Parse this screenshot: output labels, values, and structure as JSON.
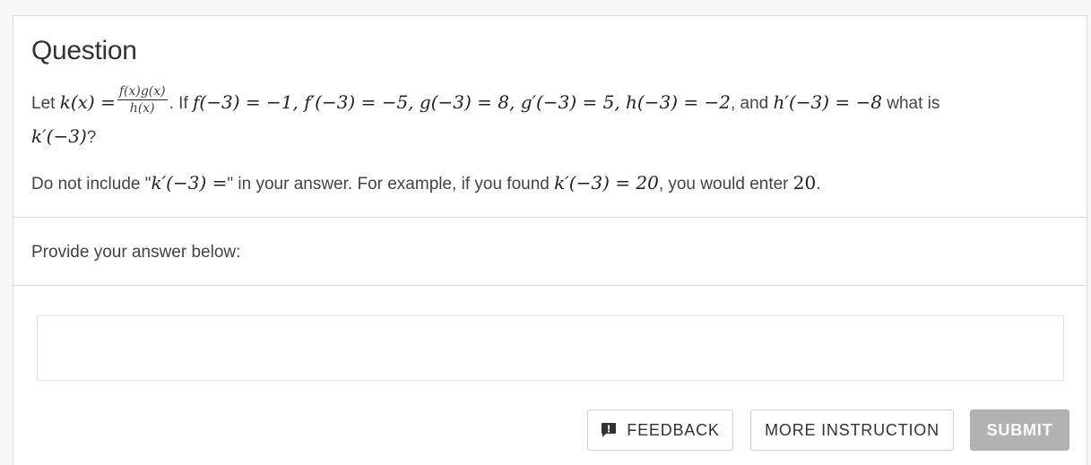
{
  "question": {
    "title": "Question",
    "intro": "Let ",
    "k_def": "k(x) =",
    "frac_num": "f(x)g(x)",
    "frac_den": "h(x)",
    "if_text": ". If ",
    "given_values": "f(−3) = −1, f′(−3) = −5, g(−3) = 8, g′(−3) = 5, h(−3) = −2",
    "and_text": ", and ",
    "h_prime": "h′(−3) = −8",
    "what_is": " what is",
    "target": "k′(−3)",
    "question_mark": "?",
    "note_pre": "Do not include \"",
    "note_expr": "k′(−3) =",
    "note_mid": "\" in your answer. For example, if you found ",
    "note_example": "k′(−3) = 20",
    "note_post": ", you would enter ",
    "note_value": "20",
    "note_end": "."
  },
  "answer": {
    "label": "Provide your answer below:",
    "value": "",
    "placeholder": ""
  },
  "buttons": {
    "feedback": "FEEDBACK",
    "more_instruction": "MORE INSTRUCTION",
    "submit": "SUBMIT"
  },
  "icons": {
    "feedback": "feedback-speech-bubble-icon"
  },
  "colors": {
    "submit_bg": "#b2b2b2",
    "page_bg": "#f7f7f7",
    "border": "#dedede"
  }
}
